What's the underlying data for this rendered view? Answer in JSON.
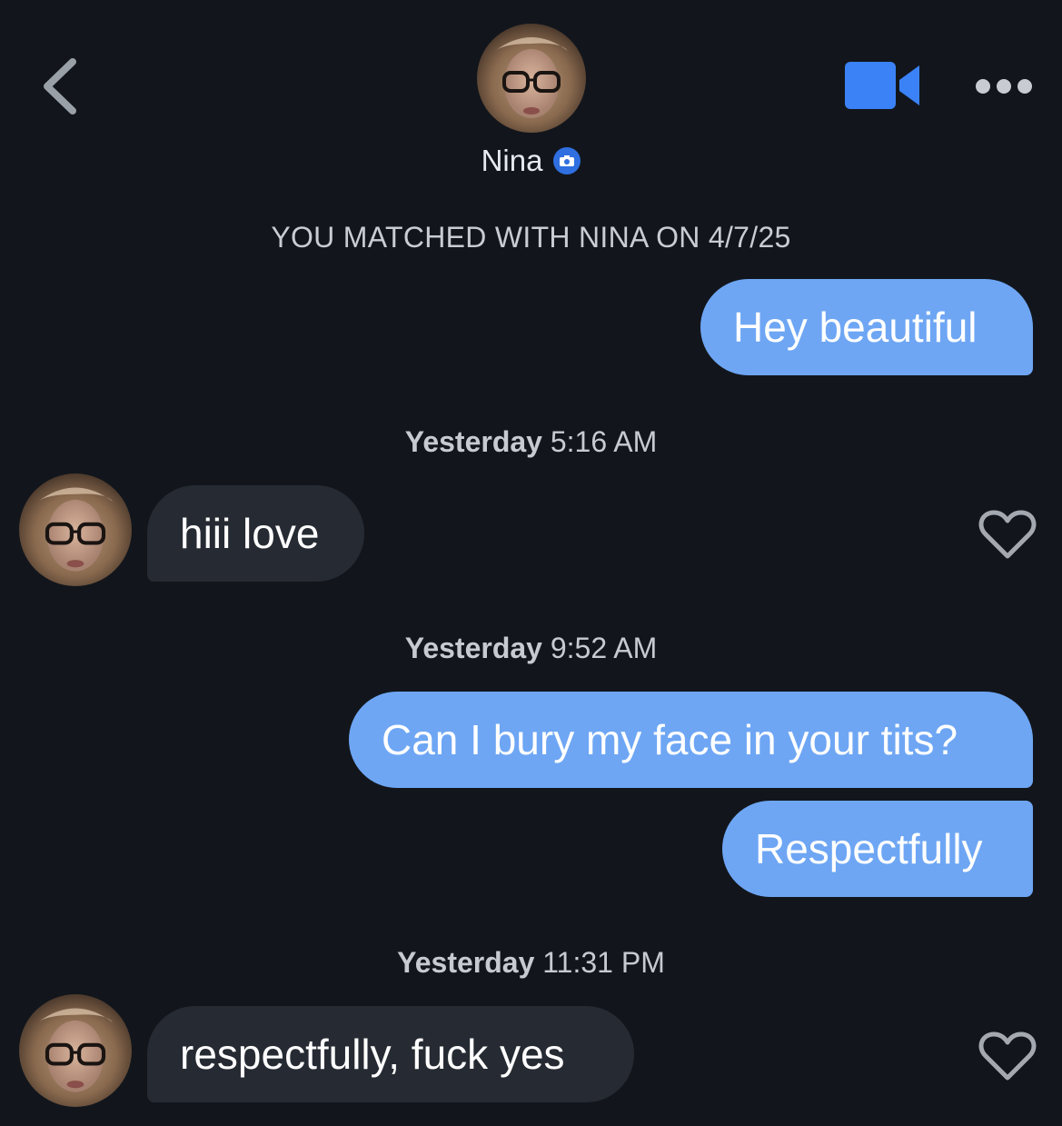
{
  "header": {
    "name": "Nina",
    "back_icon": "chevron-left-icon",
    "video_icon": "video-camera-icon",
    "more_icon": "ellipsis-icon",
    "verified_icon": "camera-verified-icon",
    "accent_color": "#3b82f6"
  },
  "match_banner": "YOU MATCHED WITH NINA ON 4/7/25",
  "messages": [
    {
      "type": "sent",
      "text": "Hey beautiful"
    },
    {
      "type": "timestamp",
      "day": "Yesterday",
      "time": "5:16 AM"
    },
    {
      "type": "received",
      "text": "hiii love"
    },
    {
      "type": "timestamp",
      "day": "Yesterday",
      "time": "9:52 AM"
    },
    {
      "type": "sent",
      "text": "Can I bury my face in your tits?"
    },
    {
      "type": "sent",
      "text": "Respectfully"
    },
    {
      "type": "timestamp",
      "day": "Yesterday",
      "time": "11:31 PM"
    },
    {
      "type": "received",
      "text": "respectfully, fuck yes"
    }
  ],
  "colors": {
    "background": "#12161c",
    "sent_bubble": "#6ea6f4",
    "received_bubble": "#262b33"
  }
}
